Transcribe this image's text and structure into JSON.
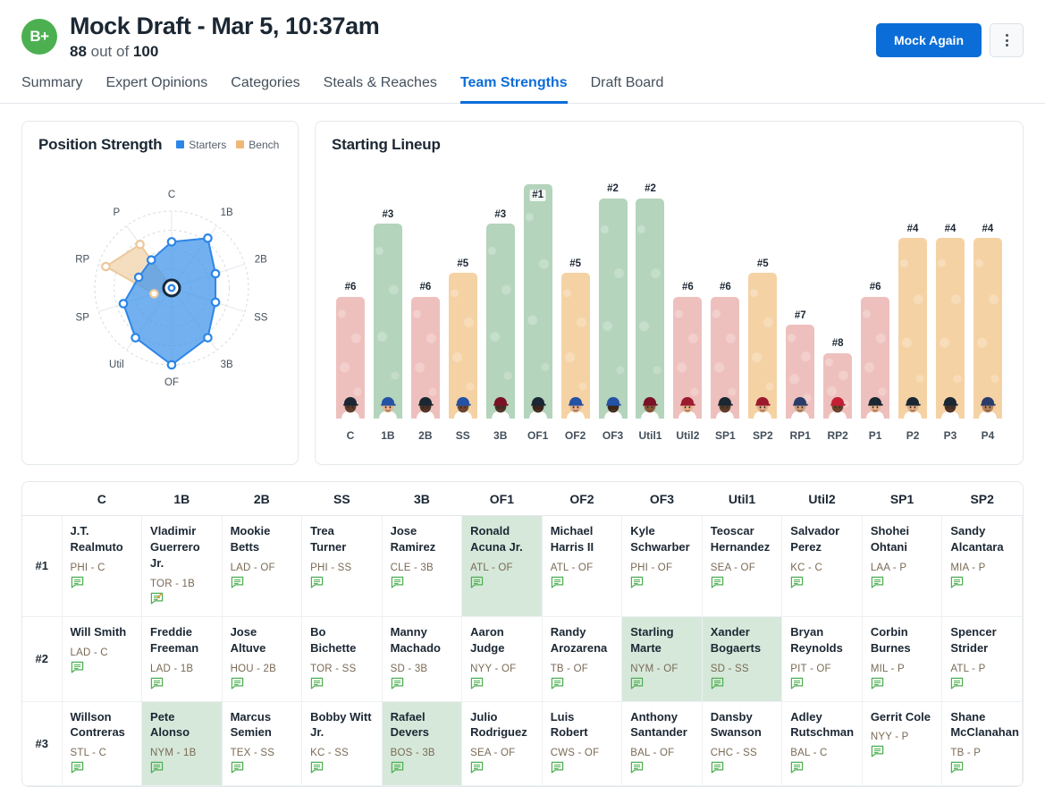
{
  "header": {
    "grade": "B+",
    "title": "Mock Draft - Mar 5, 10:37am",
    "score_value": "88",
    "score_mid": " out of ",
    "score_total": "100",
    "mock_again_label": "Mock Again",
    "menu_icon": "kebab-menu-icon"
  },
  "tabs": [
    {
      "label": "Summary",
      "active": false
    },
    {
      "label": "Expert Opinions",
      "active": false
    },
    {
      "label": "Categories",
      "active": false
    },
    {
      "label": "Steals & Reaches",
      "active": false
    },
    {
      "label": "Team Strengths",
      "active": true
    },
    {
      "label": "Draft Board",
      "active": false
    }
  ],
  "radar_card": {
    "title": "Position Strength",
    "legend": [
      {
        "label": "Starters",
        "color": "#2c86e8"
      },
      {
        "label": "Bench",
        "color": "#f0b878"
      }
    ]
  },
  "bars_card": {
    "title": "Starting Lineup"
  },
  "colors": {
    "accent_blue": "#0b6dd8",
    "grade_green": "#4cb050",
    "bar_green": "#b4d4bc",
    "bar_orange": "#f5d2a4",
    "bar_red": "#eec0bd",
    "starters_fill": "#4a9aea",
    "bench_fill": "#f3d6b0",
    "highlight_cell": "#d6e8da"
  },
  "chart_data": [
    {
      "type": "radar",
      "title": "Position Strength",
      "categories": [
        "C",
        "1B",
        "2B",
        "SS",
        "3B",
        "OF",
        "Util",
        "SP",
        "RP",
        "P"
      ],
      "rmax": 100,
      "grid": true,
      "legend_position": "top-right",
      "series": [
        {
          "name": "Starters",
          "color": "#2c86e8",
          "values": [
            60,
            80,
            60,
            60,
            80,
            100,
            80,
            66,
            45,
            45
          ]
        },
        {
          "name": "Bench",
          "color": "#f0b878",
          "values": [
            0,
            0,
            0,
            0,
            0,
            0,
            0,
            24,
            90,
            70
          ]
        }
      ]
    },
    {
      "type": "bar",
      "title": "Starting Lineup",
      "xlabel": "",
      "ylabel": "",
      "ylim": [
        0,
        100
      ],
      "categories": [
        "C",
        "1B",
        "2B",
        "SS",
        "3B",
        "OF1",
        "OF2",
        "OF3",
        "Util1",
        "Util2",
        "SP1",
        "SP2",
        "RP1",
        "RP2",
        "P1",
        "P2",
        "P3",
        "P4"
      ],
      "values": [
        52,
        83,
        52,
        62,
        83,
        100,
        62,
        94,
        94,
        52,
        52,
        62,
        40,
        28,
        52,
        77,
        77,
        77
      ],
      "rank_labels": [
        "#6",
        "#3",
        "#6",
        "#5",
        "#3",
        "#1",
        "#5",
        "#2",
        "#2",
        "#6",
        "#6",
        "#5",
        "#7",
        "#8",
        "#6",
        "#4",
        "#4",
        "#4"
      ],
      "bar_colors": [
        "#eec0bd",
        "#b4d4bc",
        "#eec0bd",
        "#f5d2a4",
        "#b4d4bc",
        "#b4d4bc",
        "#f5d2a4",
        "#b4d4bc",
        "#b4d4bc",
        "#eec0bd",
        "#eec0bd",
        "#f5d2a4",
        "#eec0bd",
        "#eec0bd",
        "#eec0bd",
        "#f5d2a4",
        "#f5d2a4",
        "#f5d2a4"
      ],
      "label_inside": [
        false,
        false,
        false,
        false,
        false,
        true,
        false,
        false,
        false,
        false,
        false,
        false,
        false,
        false,
        false,
        false,
        false,
        false
      ],
      "avatar_skin": [
        "#5b3a28",
        "#e8b48e",
        "#4a3124",
        "#6d4630",
        "#4a3124",
        "#3b241a",
        "#e3b189",
        "#3e2619",
        "#8a5a3c",
        "#e8b48e",
        "#5a3a27",
        "#e3b189",
        "#cfa07c",
        "#6b432c",
        "#e8b48e",
        "#e3b189",
        "#4a3124",
        "#b8845c"
      ],
      "avatar_cap": [
        "#1b2733",
        "#2452a4",
        "#1b2733",
        "#2452a4",
        "#7a1226",
        "#1b2733",
        "#2452a4",
        "#2452a4",
        "#7a1226",
        "#9c1a2e",
        "#1b2733",
        "#9c1a2e",
        "#2b3c6b",
        "#c41f35",
        "#1b2733",
        "#1b2733",
        "#1b2733",
        "#2b3c6b"
      ]
    }
  ],
  "lineup_table": {
    "row_label_header": "",
    "columns": [
      "C",
      "1B",
      "2B",
      "SS",
      "3B",
      "OF1",
      "OF2",
      "OF3",
      "Util1",
      "Util2",
      "SP1",
      "SP2"
    ],
    "rows": [
      {
        "label": "#1",
        "cells": [
          {
            "name": "J.T. Realmuto",
            "team": "PHI - C",
            "highlight": false,
            "edited": false
          },
          {
            "name": "Vladimir Guerrero Jr.",
            "team": "TOR - 1B",
            "highlight": false,
            "edited": true
          },
          {
            "name": "Mookie Betts",
            "team": "LAD - OF",
            "highlight": false,
            "edited": false
          },
          {
            "name": "Trea Turner",
            "team": "PHI - SS",
            "highlight": false,
            "edited": false
          },
          {
            "name": "Jose Ramirez",
            "team": "CLE - 3B",
            "highlight": false,
            "edited": false
          },
          {
            "name": "Ronald Acuna Jr.",
            "team": "ATL - OF",
            "highlight": true,
            "edited": false
          },
          {
            "name": "Michael Harris II",
            "team": "ATL - OF",
            "highlight": false,
            "edited": false
          },
          {
            "name": "Kyle Schwarber",
            "team": "PHI - OF",
            "highlight": false,
            "edited": false
          },
          {
            "name": "Teoscar Hernandez",
            "team": "SEA - OF",
            "highlight": false,
            "edited": false
          },
          {
            "name": "Salvador Perez",
            "team": "KC - C",
            "highlight": false,
            "edited": false
          },
          {
            "name": "Shohei Ohtani",
            "team": "LAA - P",
            "highlight": false,
            "edited": false
          },
          {
            "name": "Sandy Alcantara",
            "team": "MIA - P",
            "highlight": false,
            "edited": false
          }
        ]
      },
      {
        "label": "#2",
        "cells": [
          {
            "name": "Will Smith",
            "team": "LAD - C",
            "highlight": false,
            "edited": false
          },
          {
            "name": "Freddie Freeman",
            "team": "LAD - 1B",
            "highlight": false,
            "edited": false
          },
          {
            "name": "Jose Altuve",
            "team": "HOU - 2B",
            "highlight": false,
            "edited": false
          },
          {
            "name": "Bo Bichette",
            "team": "TOR - SS",
            "highlight": false,
            "edited": false
          },
          {
            "name": "Manny Machado",
            "team": "SD - 3B",
            "highlight": false,
            "edited": false
          },
          {
            "name": "Aaron Judge",
            "team": "NYY - OF",
            "highlight": false,
            "edited": false
          },
          {
            "name": "Randy Arozarena",
            "team": "TB - OF",
            "highlight": false,
            "edited": false
          },
          {
            "name": "Starling Marte",
            "team": "NYM - OF",
            "highlight": true,
            "edited": false
          },
          {
            "name": "Xander Bogaerts",
            "team": "SD - SS",
            "highlight": true,
            "edited": false
          },
          {
            "name": "Bryan Reynolds",
            "team": "PIT - OF",
            "highlight": false,
            "edited": false
          },
          {
            "name": "Corbin Burnes",
            "team": "MIL - P",
            "highlight": false,
            "edited": false
          },
          {
            "name": "Spencer Strider",
            "team": "ATL - P",
            "highlight": false,
            "edited": false
          }
        ]
      },
      {
        "label": "#3",
        "cells": [
          {
            "name": "Willson Contreras",
            "team": "STL - C",
            "highlight": false,
            "edited": false
          },
          {
            "name": "Pete Alonso",
            "team": "NYM - 1B",
            "highlight": true,
            "edited": false
          },
          {
            "name": "Marcus Semien",
            "team": "TEX - SS",
            "highlight": false,
            "edited": false
          },
          {
            "name": "Bobby Witt Jr.",
            "team": "KC - SS",
            "highlight": false,
            "edited": false
          },
          {
            "name": "Rafael Devers",
            "team": "BOS - 3B",
            "highlight": true,
            "edited": false
          },
          {
            "name": "Julio Rodriguez",
            "team": "SEA - OF",
            "highlight": false,
            "edited": false
          },
          {
            "name": "Luis Robert",
            "team": "CWS - OF",
            "highlight": false,
            "edited": false
          },
          {
            "name": "Anthony Santander",
            "team": "BAL - OF",
            "highlight": false,
            "edited": false
          },
          {
            "name": "Dansby Swanson",
            "team": "CHC - SS",
            "highlight": false,
            "edited": false
          },
          {
            "name": "Adley Rutschman",
            "team": "BAL - C",
            "highlight": false,
            "edited": false
          },
          {
            "name": "Gerrit Cole",
            "team": "NYY - P",
            "highlight": false,
            "edited": false
          },
          {
            "name": "Shane McClanahan",
            "team": "TB - P",
            "highlight": false,
            "edited": false
          }
        ]
      }
    ]
  }
}
